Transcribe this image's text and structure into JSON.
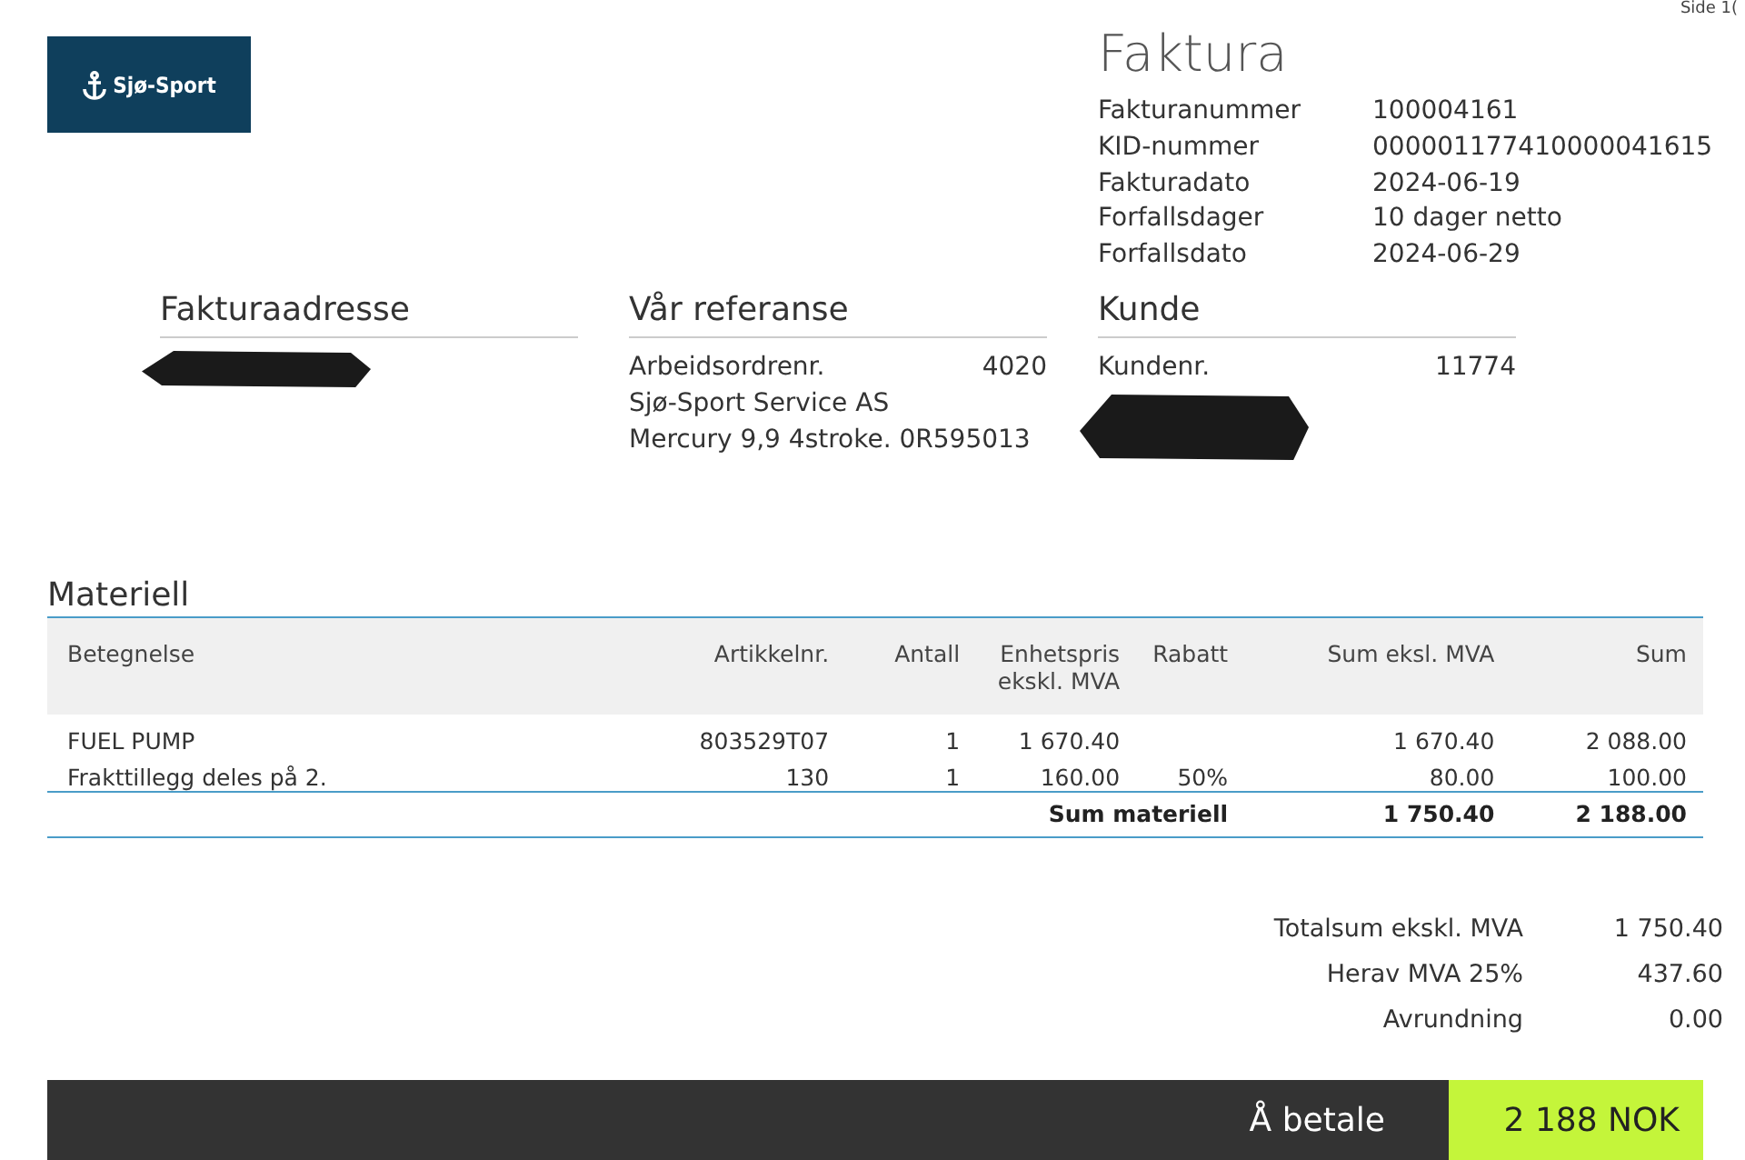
{
  "page_label": "Side 1(",
  "logo": {
    "text": "Sjø-Sport"
  },
  "title": "Faktura",
  "invoice_meta": [
    {
      "label": "Fakturanummer",
      "value": "100004161"
    },
    {
      "label": "KID-nummer",
      "value": "000001177410000041615"
    },
    {
      "label": "Fakturadato",
      "value": "2024-06-19"
    },
    {
      "label": "Forfallsdager",
      "value": "10 dager netto"
    },
    {
      "label": "Forfallsdato",
      "value": "2024-06-29"
    }
  ],
  "sections": [
    {
      "heading": "Fakturaadresse",
      "redacted": true
    },
    {
      "heading": "Vår referanse",
      "lines": [
        {
          "label": "Arbeidsordrenr.",
          "value": "4020"
        },
        {
          "label": "Sjø-Sport Service AS"
        },
        {
          "label": "Mercury 9,9 4stroke. 0R595013"
        }
      ],
      "redacted": false
    },
    {
      "heading": "Kunde",
      "lines": [
        {
          "label": "Kundenr.",
          "value": "11774"
        }
      ],
      "redacted": true
    }
  ],
  "materials": {
    "heading": "Materiell",
    "columns": [
      "Betegnelse",
      "Artikkelnr.",
      "Antall",
      "Enhetspris ekskl. MVA",
      "Rabatt",
      "Sum eksl. MVA",
      "Sum"
    ],
    "rows": [
      [
        "FUEL PUMP",
        "803529T07",
        "1",
        "1 670.40",
        "",
        "1 670.40",
        "2 088.00"
      ],
      [
        "Frakttillegg deles på 2.",
        "130",
        "1",
        "160.00",
        "50%",
        "80.00",
        "100.00"
      ]
    ],
    "total": {
      "label": "Sum materiell",
      "excl": "1 750.40",
      "sum": "2 188.00"
    }
  },
  "totals": [
    {
      "label": "Totalsum ekskl. MVA",
      "value": "1 750.40"
    },
    {
      "label": "Herav MVA 25%",
      "value": "437.60"
    },
    {
      "label": "Avrundning",
      "value": "0.00"
    }
  ],
  "pay": {
    "label": "Å betale",
    "value": "2 188 NOK"
  }
}
